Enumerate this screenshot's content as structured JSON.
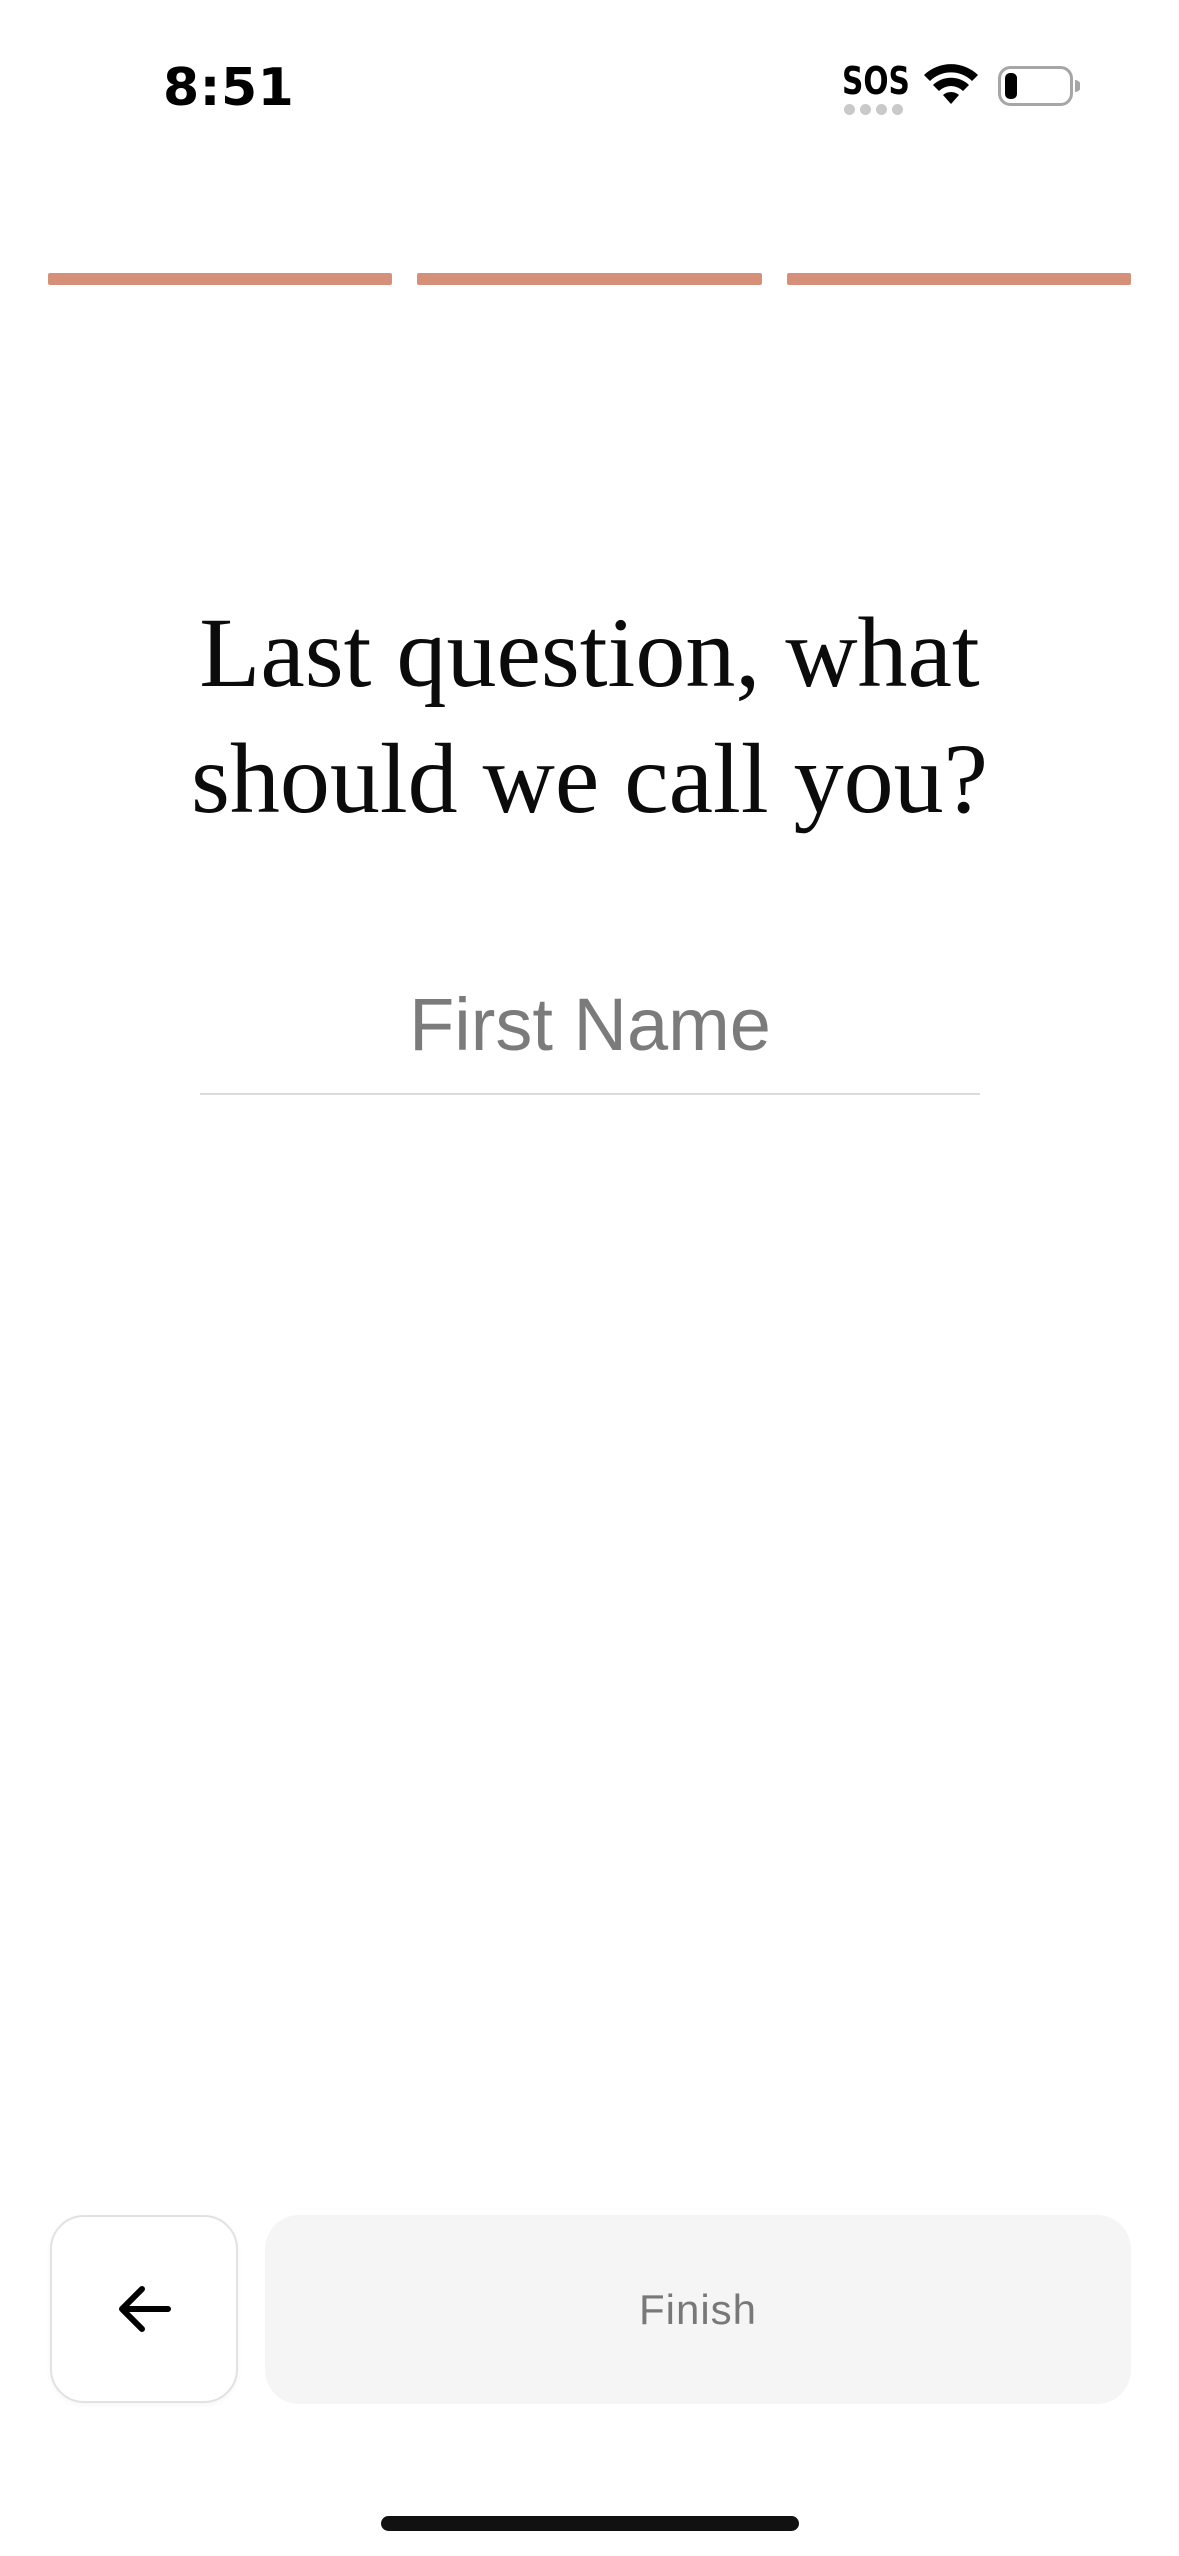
{
  "status_bar": {
    "time": "8:51",
    "sos": "SOS",
    "wifi_icon": "wifi-icon",
    "battery_icon": "battery-icon"
  },
  "progress": {
    "total_steps": 3,
    "completed_steps": 3,
    "color": "#d6907a"
  },
  "question": {
    "title": "Last question, what\nshould we call you?"
  },
  "name_field": {
    "placeholder": "First Name",
    "value": ""
  },
  "footer": {
    "back_icon": "arrow-left-icon",
    "finish_label": "Finish"
  },
  "colors": {
    "accent": "#d6907a",
    "button_disabled_bg": "#f5f5f5",
    "button_disabled_text": "#787878"
  }
}
